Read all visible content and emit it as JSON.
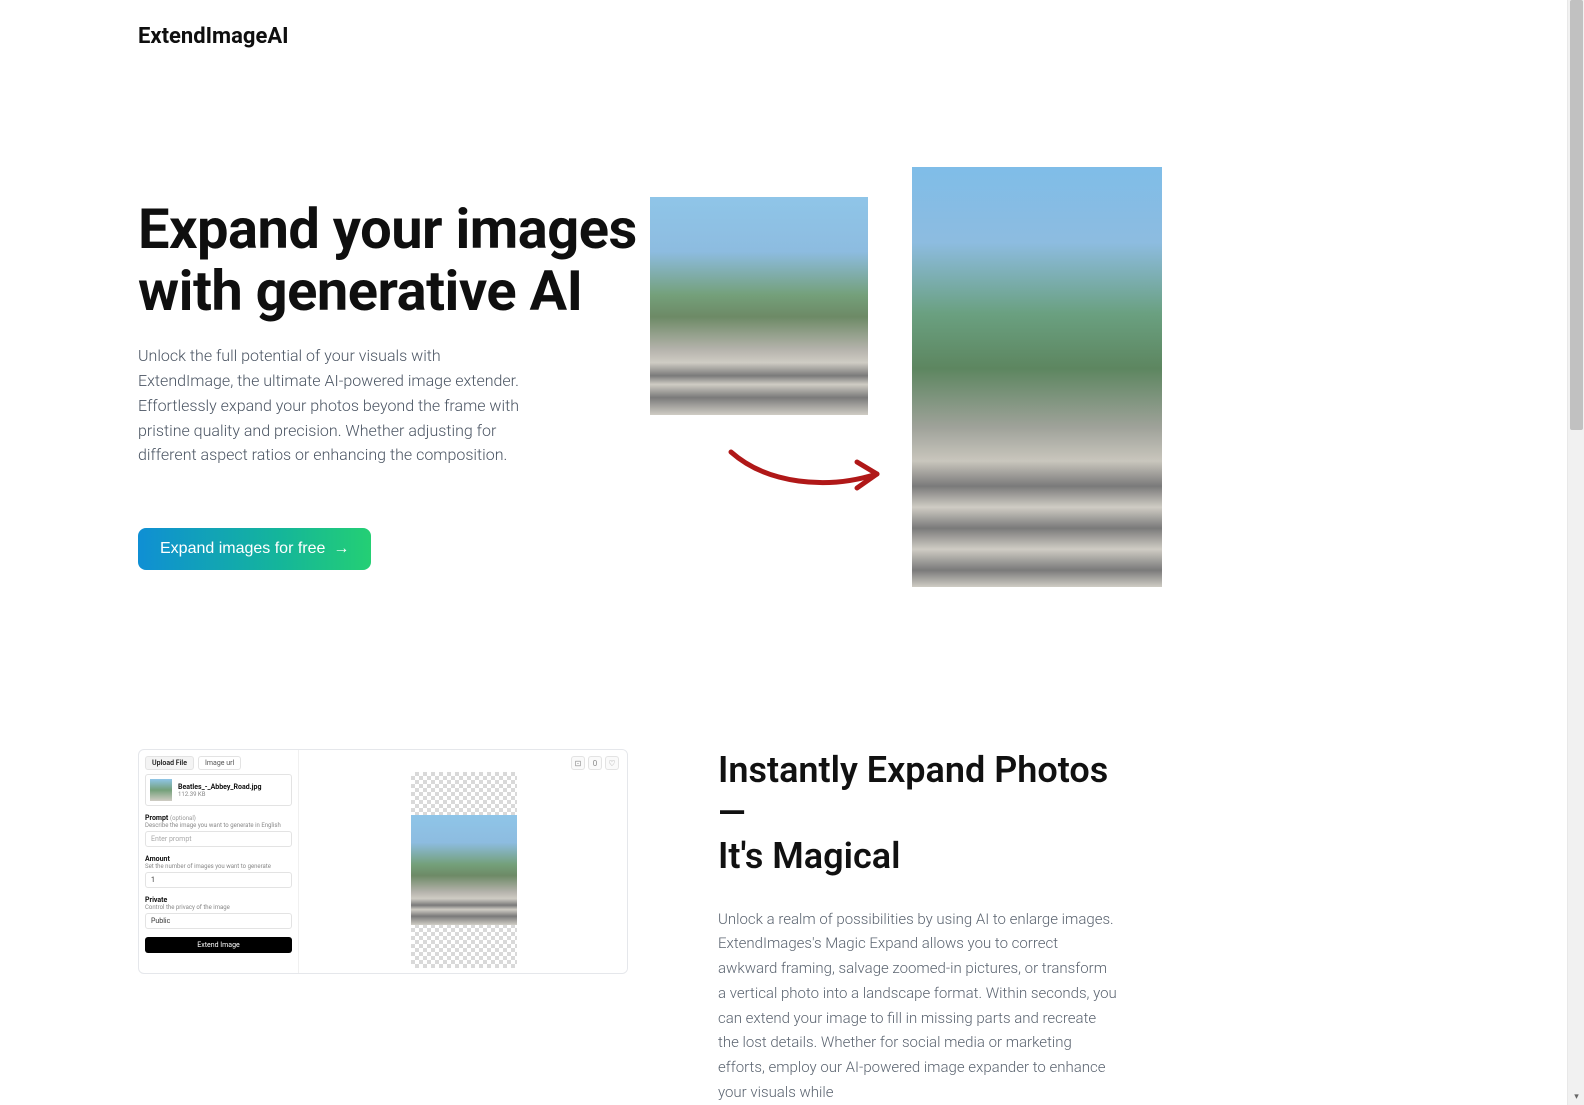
{
  "brand": "ExtendImageAI",
  "hero": {
    "title_line1": "Expand your images",
    "title_line2": "with generative AI",
    "subtitle": "Unlock the full potential of your visuals with ExtendImage, the ultimate AI-powered image extender. Effortlessly expand your photos beyond the frame with pristine quality and precision. Whether adjusting for different aspect ratios or enhancing the composition.",
    "cta_label": "Expand images for free"
  },
  "tool": {
    "tab_upload": "Upload File",
    "tab_image": "Image url",
    "file_name": "Beatles_-_Abbey_Road.jpg",
    "file_size": "112.39 KB",
    "prompt_label": "Prompt",
    "prompt_optional": "(optional)",
    "prompt_help": "Describe the image you want to generate in English",
    "prompt_placeholder": "Enter prompt",
    "amount_label": "Amount",
    "amount_help": "Set the number of images you want to generate",
    "amount_value": "1",
    "private_label": "Private",
    "private_help": "Control the privacy of the image",
    "private_value": "Public",
    "submit": "Extend Image",
    "canvas_zero": "0"
  },
  "section2": {
    "title_line1": "Instantly Expand Photos—",
    "title_line2": "It's Magical",
    "body": "Unlock a realm of possibilities by using AI to enlarge images. ExtendImages's Magic Expand allows you to correct awkward framing, salvage zoomed-in pictures, or transform a vertical photo into a landscape format. Within seconds, you can extend your image to fill in missing parts and recreate the lost details. Whether for social media or marketing efforts, employ our AI-powered image expander to enhance your visuals while"
  }
}
